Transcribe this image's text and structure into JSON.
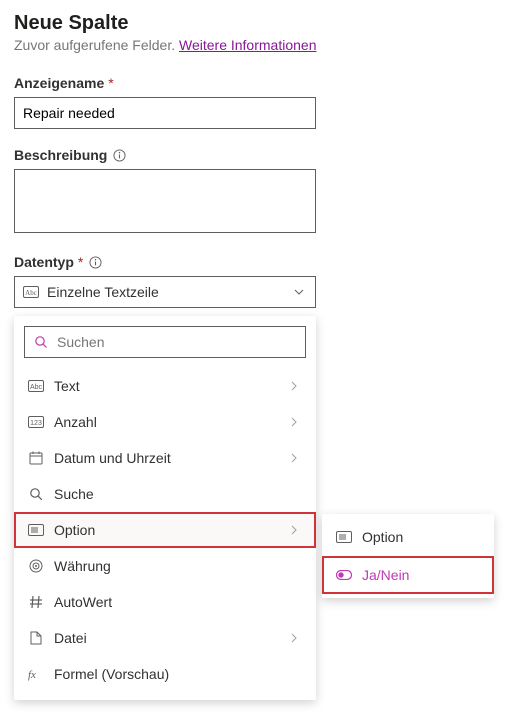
{
  "title": "Neue Spalte",
  "subtitle_text": "Zuvor aufgerufene Felder. ",
  "subtitle_link": "Weitere Informationen",
  "fields": {
    "display_name": {
      "label": "Anzeigename",
      "value": "Repair needed"
    },
    "description": {
      "label": "Beschreibung",
      "value": ""
    },
    "datatype": {
      "label": "Datentyp",
      "selected": "Einzelne Textzeile"
    }
  },
  "dropdown": {
    "search_placeholder": "Suchen",
    "items": {
      "text": "Text",
      "number": "Anzahl",
      "datetime": "Datum und Uhrzeit",
      "lookup": "Suche",
      "option": "Option",
      "currency": "Währung",
      "autonumber": "AutoWert",
      "file": "Datei",
      "formula": "Formel (Vorschau)"
    }
  },
  "submenu": {
    "option": "Option",
    "yesno": "Ja/Nein"
  }
}
